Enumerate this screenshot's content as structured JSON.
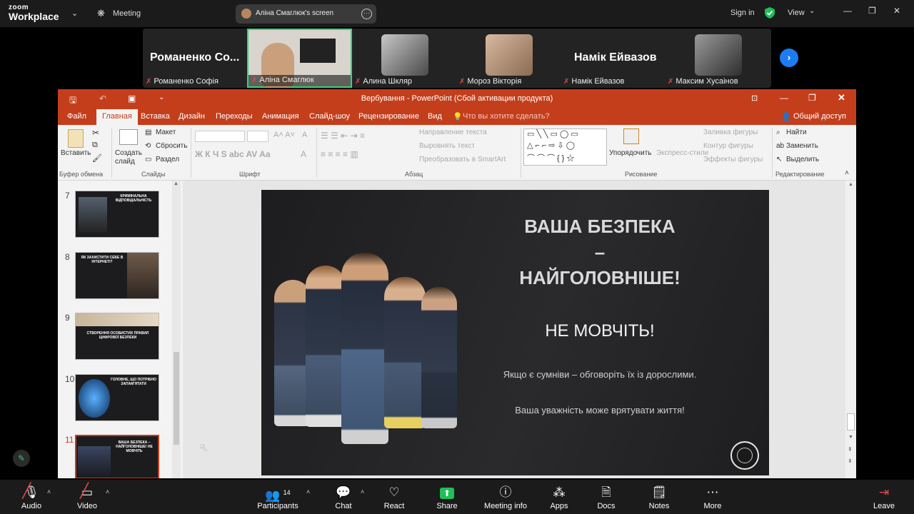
{
  "zoom": {
    "logo_line1": "zoom",
    "logo_line2": "Workplace",
    "meeting_label": "Meeting",
    "share_label": "Аліна Смаглюк's screen",
    "sign_in": "Sign in",
    "view": "View"
  },
  "participants_strip": [
    {
      "big_name": "Романенко Со...",
      "label": "Романенко Софія"
    },
    {
      "big_name": "",
      "label": "Аліна Смаглюк"
    },
    {
      "big_name": "",
      "label": "Алина Шкляр"
    },
    {
      "big_name": "",
      "label": "Мороз Вікторія"
    },
    {
      "big_name": "Намік Ейвазов",
      "label": "Намік Ейвазов"
    },
    {
      "big_name": "",
      "label": "Максим Хусаінов"
    }
  ],
  "ppt": {
    "title": "Вербування - PowerPoint (Сбой активации продукта)",
    "tabs": [
      "Файл",
      "Главная",
      "Вставка",
      "Дизайн",
      "Переходы",
      "Анимация",
      "Слайд-шоу",
      "Рецензирование",
      "Вид"
    ],
    "tell_me": "Что вы хотите сделать?",
    "share": "Общий доступ",
    "ribbon": {
      "paste": "Вставить",
      "clipboard": "Буфер обмена",
      "new_slide": "Создать слайд",
      "layout": "Макет",
      "reset": "Сбросить",
      "section": "Раздел",
      "slides": "Слайды",
      "font": "Шрифт",
      "text_dir": "Направление текста",
      "align_text": "Выровнять текст",
      "smartart": "Преобразовать в SmartArt",
      "paragraph": "Абзац",
      "arrange": "Упорядочить",
      "quick_styles": "Экспресс-стили",
      "shape_fill": "Заливка фигуры",
      "shape_outline": "Контур фигуры",
      "shape_effects": "Эффекты фигуры",
      "drawing": "Рисование",
      "find": "Найти",
      "replace": "Заменить",
      "select": "Выделить",
      "editing": "Редактирование"
    },
    "thumbnails": [
      {
        "num": "7",
        "title": "КРИМІНАЛЬНА ВІДПОВІДАЛЬНІСТЬ"
      },
      {
        "num": "8",
        "title": "ЯК ЗАХИСТИТИ СЕБЕ В ІНТЕРНЕТІ?"
      },
      {
        "num": "9",
        "title": "СТВОРЕННЯ ОСОБИСТИХ ПРАВИЛ ЦИФРОВОЇ БЕЗПЕКИ"
      },
      {
        "num": "10",
        "title": "ГОЛОВНЕ, ЩО ПОТРІБНО ЗАПАМ'ЯТАТИ"
      },
      {
        "num": "11",
        "title": "ВАША БЕЗПЕКА – НАЙГОЛОВНІШЕ! НЕ МОВЧІТЬ"
      }
    ],
    "slide": {
      "heading1": "ВАША БЕЗПЕКА",
      "dash": "–",
      "heading2": "НАЙГОЛОВНІШЕ!",
      "subheading": "НЕ МОВЧІТЬ!",
      "line1": "Якщо є сумніви – обговоріть їх із дорослими.",
      "line2": "Ваша уважність може врятувати життя!"
    }
  },
  "bottom": {
    "audio": "Audio",
    "video": "Video",
    "participants": "Participants",
    "participants_count": "14",
    "chat": "Chat",
    "react": "React",
    "share": "Share",
    "meeting_info": "Meeting info",
    "apps": "Apps",
    "docs": "Docs",
    "notes": "Notes",
    "more": "More",
    "leave": "Leave"
  },
  "colors": {
    "ppt_accent": "#c43e1c",
    "share_green": "#1fbf5a",
    "leave_red": "#e24b4b",
    "active_speaker": "#2fd67b"
  }
}
